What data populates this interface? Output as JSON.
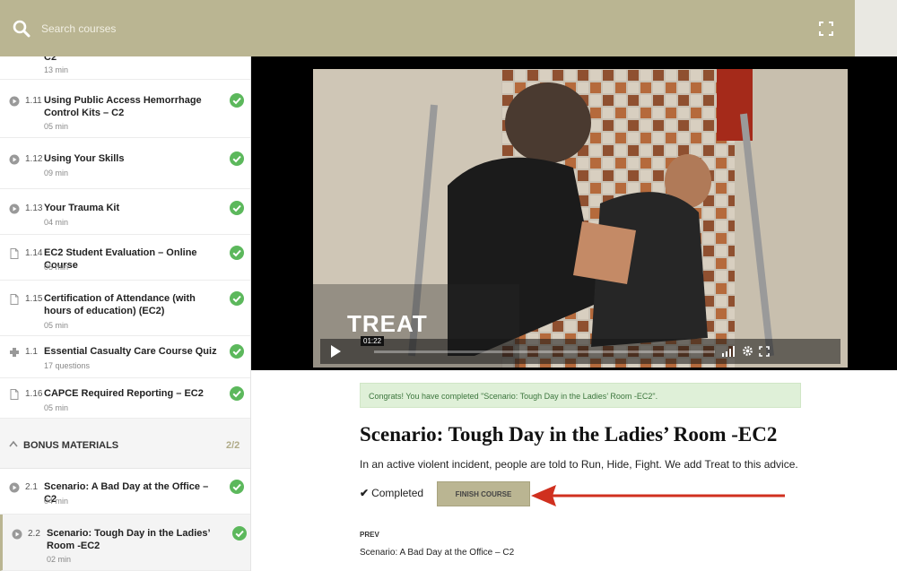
{
  "search": {
    "placeholder": "Search courses"
  },
  "sidebar": {
    "top_partial": {
      "title": "C2",
      "meta": "13 min"
    },
    "lessons": [
      {
        "num": "1.11",
        "title": "Using Public Access Hemorrhage Control Kits – C2",
        "meta": "05 min",
        "type": "video"
      },
      {
        "num": "1.12",
        "title": "Using Your Skills",
        "meta": "09 min",
        "type": "video"
      },
      {
        "num": "1.13",
        "title": "Your Trauma Kit",
        "meta": "04 min",
        "type": "video"
      },
      {
        "num": "1.14",
        "title": "EC2 Student Evaluation – Online Course",
        "meta": "05 min",
        "type": "document"
      },
      {
        "num": "1.15",
        "title": "Certification of Attendance (with hours of education) (EC2)",
        "meta": "05 min",
        "type": "document"
      },
      {
        "num": "1.1",
        "title": "Essential Casualty Care Course Quiz",
        "meta": "17 questions",
        "type": "quiz"
      },
      {
        "num": "1.16",
        "title": "CAPCE Required Reporting – EC2",
        "meta": "05 min",
        "type": "document"
      }
    ],
    "section": {
      "label": "BONUS MATERIALS",
      "count": "2/2"
    },
    "bonus": [
      {
        "num": "2.1",
        "title": "Scenario: A Bad Day at the Office – C2",
        "meta": "04 min",
        "type": "video"
      },
      {
        "num": "2.2",
        "title": "Scenario: Tough Day in the Ladies’ Room -EC2",
        "meta": "02 min",
        "type": "video"
      }
    ]
  },
  "video": {
    "overlay_text": "TREAT",
    "time": "01:22",
    "progress": 0.0
  },
  "main": {
    "notice": "Congrats! You have completed \"Scenario: Tough Day in the Ladies’ Room -EC2\".",
    "title": "Scenario: Tough Day in the Ladies’ Room -EC2",
    "description": "In an active violent incident, people are told to Run, Hide, Fight. We add Treat to this advice.",
    "completed_label": "Completed",
    "finish_button": "FINISH COURSE",
    "prev_label": "PREV",
    "prev_link": "Scenario: A Bad Day at the Office – C2"
  },
  "colors": {
    "topbar": "#bab592",
    "check": "#5cb85c",
    "arrow": "#d0301f",
    "notice_bg": "#dff0d8"
  }
}
